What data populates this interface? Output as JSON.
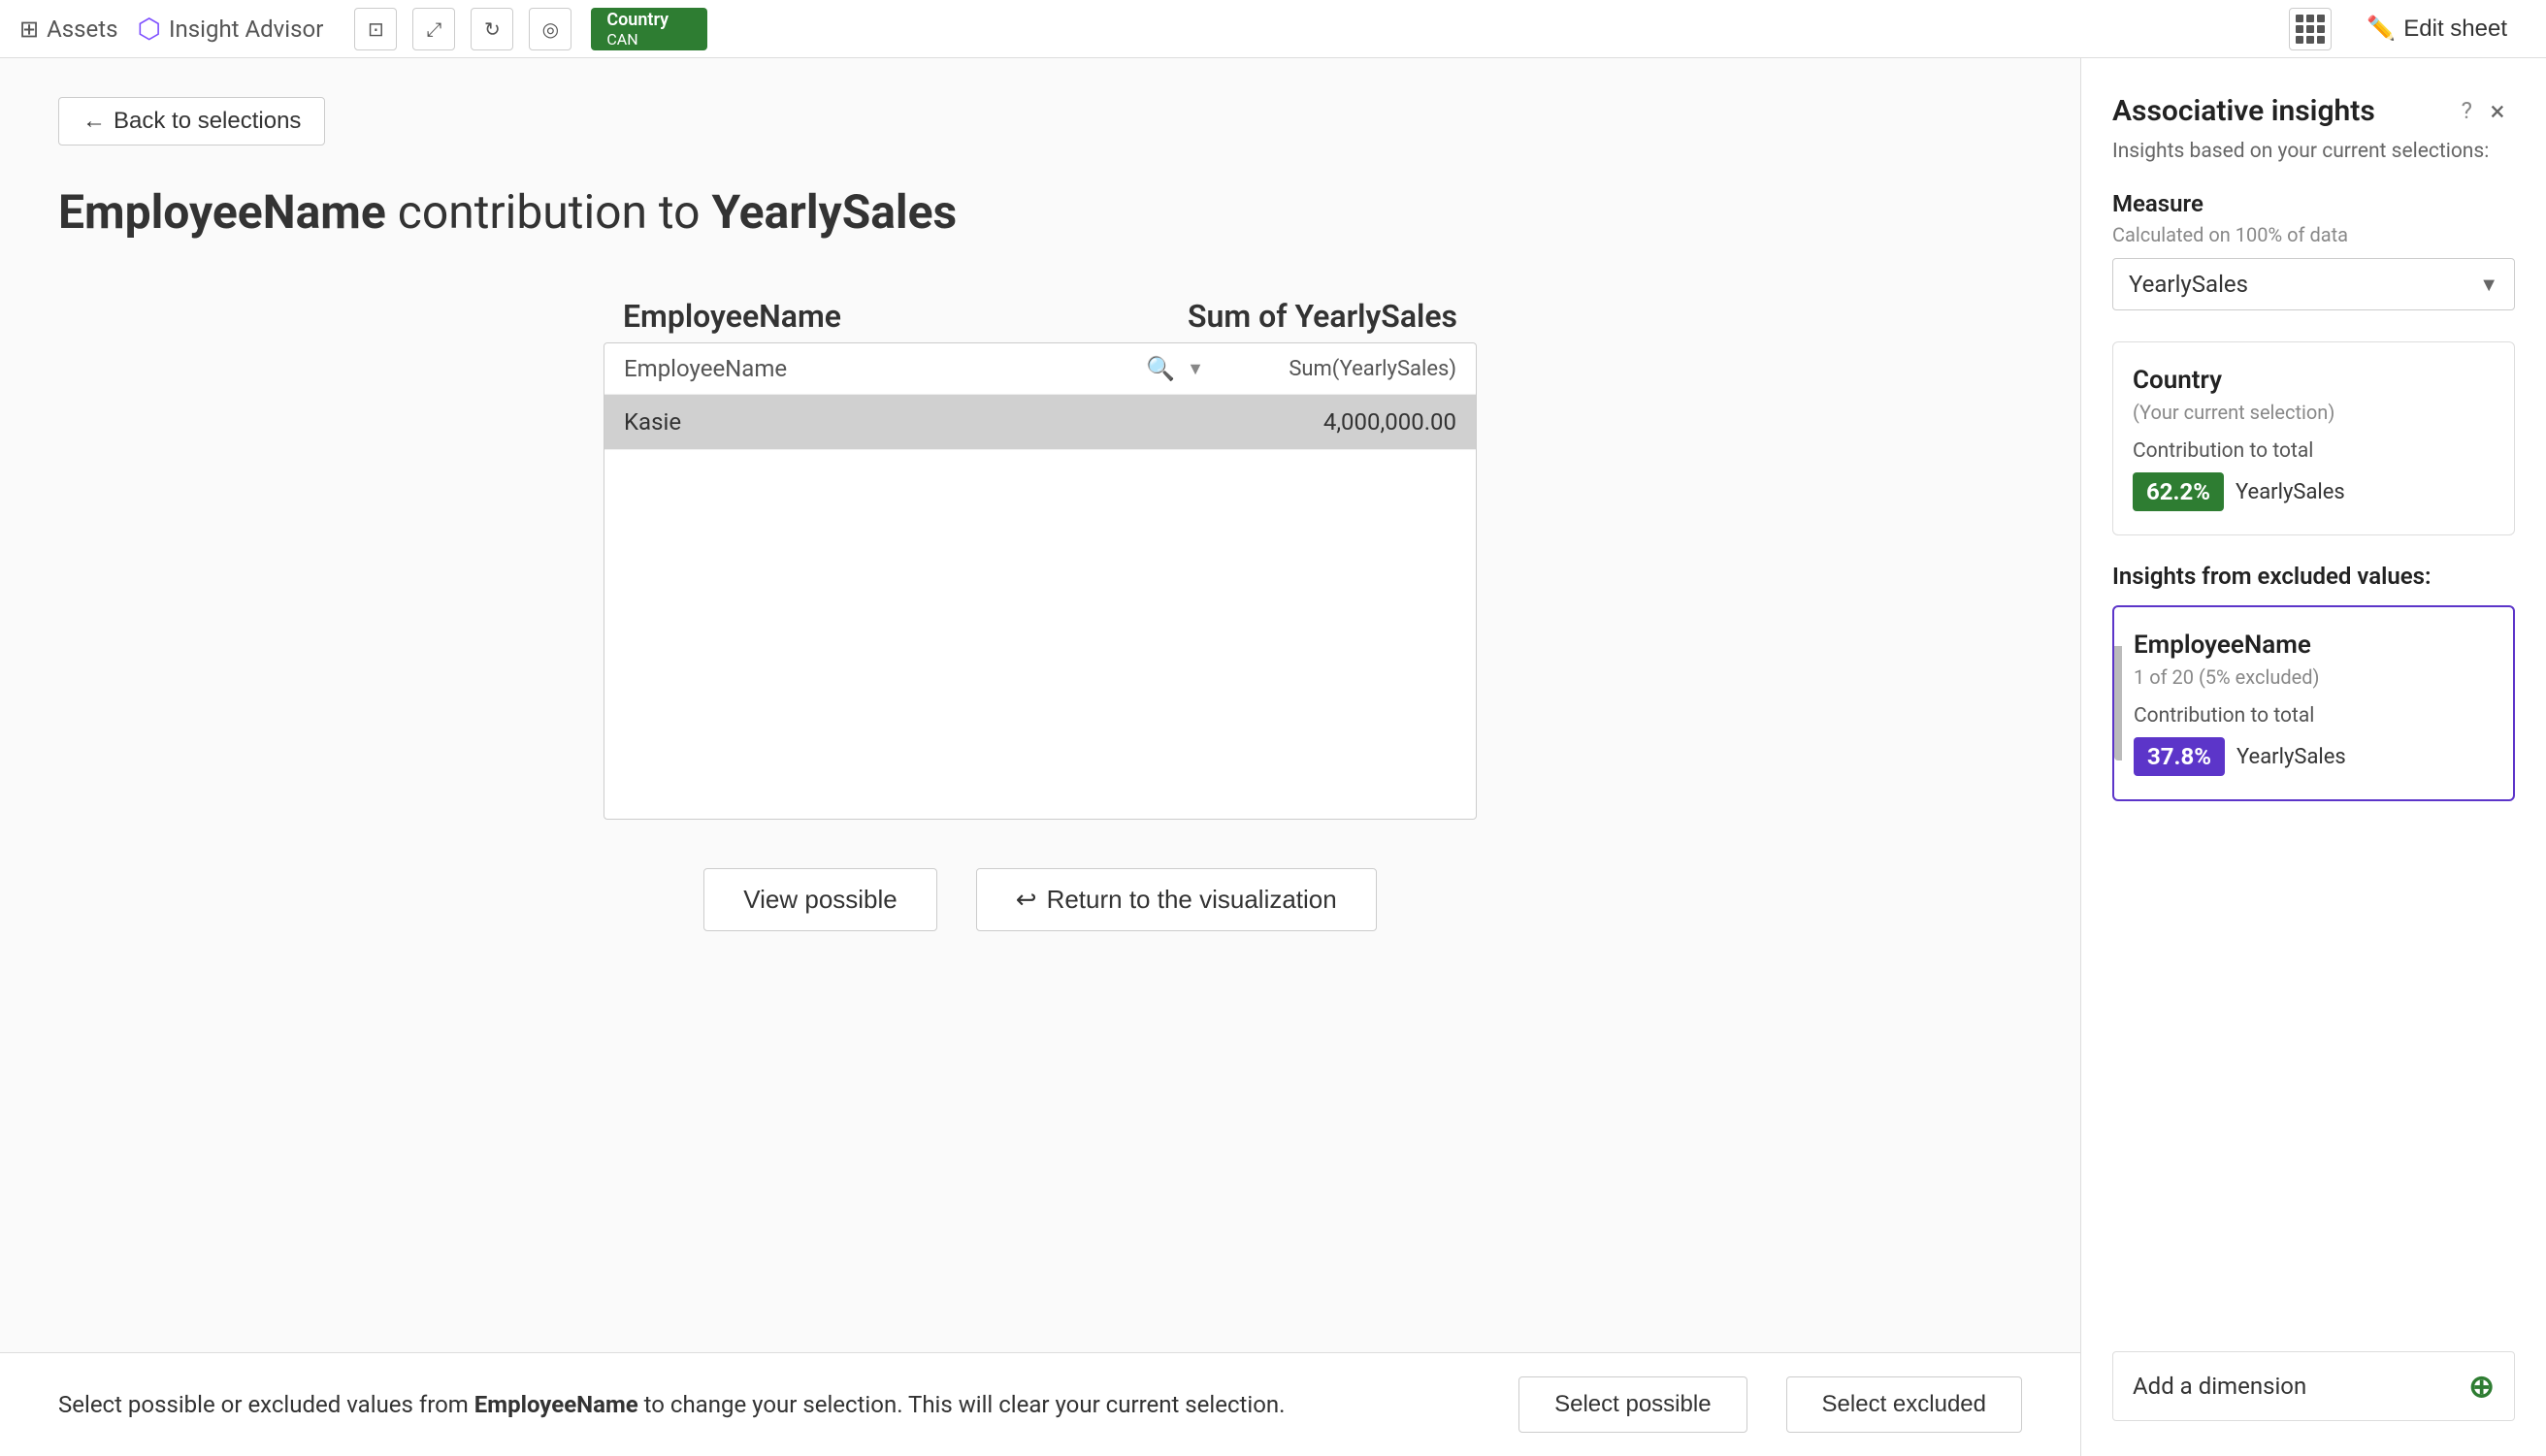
{
  "topbar": {
    "assets_label": "Assets",
    "insight_label": "Insight Advisor",
    "selection_field": "Country",
    "selection_value": "CAN",
    "edit_sheet_label": "Edit sheet"
  },
  "back_button": "Back to selections",
  "page_title_prefix": "EmployeeName",
  "page_title_middle": " contribution to ",
  "page_title_suffix": "YearlySales",
  "table": {
    "col_dimension": "EmployeeName",
    "col_measure": "Sum of YearlySales",
    "search_placeholder": "EmployeeName",
    "col_measure_header": "Sum(YearlySales)",
    "row_name": "Kasie",
    "row_value": "4,000,000.00"
  },
  "action_buttons": {
    "view_possible": "View possible",
    "return_visualization": "Return to the visualization"
  },
  "bottom_bar": {
    "text_prefix": "Select possible or excluded values from ",
    "field_name": "EmployeeName",
    "text_suffix": " to change your selection. This will clear your current selection.",
    "select_possible": "Select possible",
    "select_excluded": "Select excluded"
  },
  "sidebar": {
    "title": "Associative insights",
    "subtitle": "Insights based on your current selections:",
    "close_icon": "×",
    "help_icon": "?",
    "measure_section": "Measure",
    "measure_sublabel": "Calculated on 100% of data",
    "measure_value": "YearlySales",
    "current_selection_card": {
      "title": "Country",
      "subtitle": "(Your current selection)",
      "contrib_label": "Contribution to total",
      "badge": "62.2%",
      "measure_label": "YearlySales"
    },
    "excluded_section_label": "Insights from excluded values:",
    "excluded_card": {
      "title": "EmployeeName",
      "subtitle": "1 of 20 (5% excluded)",
      "contrib_label": "Contribution to total",
      "badge": "37.8%",
      "measure_label": "YearlySales"
    },
    "add_dimension_label": "Add a dimension"
  }
}
